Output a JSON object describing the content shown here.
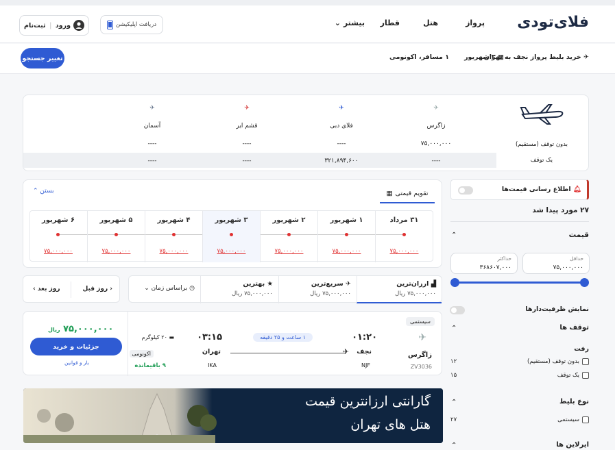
{
  "header": {
    "logo": "فلای‌تودی",
    "nav": [
      "پرواز",
      "هتل",
      "قطار",
      "بیشتر"
    ],
    "app_download": "دریافت اپلیکیشن",
    "login": "ورود",
    "signup": "ثبت‌نام"
  },
  "search_summary": {
    "route": "خرید بلیط پرواز نجف به تهران",
    "date": "۳ شهریور",
    "passengers": "۱ مسافر، اکونومی",
    "change_button": "تغییر جستجو"
  },
  "airline_table": {
    "row_labels": [
      "بدون توقف (مستقیم)",
      "یک توقف"
    ],
    "airlines": [
      {
        "name": "زاگرس",
        "direct": "۷۵,۰۰۰,۰۰۰",
        "one_stop": "----"
      },
      {
        "name": "فلای دبی",
        "direct": "----",
        "one_stop": "۳۲۱,۸۹۴,۶۰۰"
      },
      {
        "name": "قشم ایر",
        "direct": "----",
        "one_stop": "----"
      },
      {
        "name": "آسمان",
        "direct": "----",
        "one_stop": "----"
      }
    ]
  },
  "price_calendar": {
    "tab": "تقویم قیمتی",
    "close": "بستن",
    "dates": [
      {
        "label": "۳۱ مرداد",
        "price": "۷۵,۰۰۰,۰۰۰"
      },
      {
        "label": "۱ شهریور",
        "price": "۷۵,۰۰۰,۰۰۰"
      },
      {
        "label": "۲ شهریور",
        "price": "۷۵,۰۰۰,۰۰۰"
      },
      {
        "label": "۳ شهریور",
        "price": "۷۵,۰۰۰,۰۰۰"
      },
      {
        "label": "۴ شهریور",
        "price": "۷۵,۰۰۰,۰۰۰"
      },
      {
        "label": "۵ شهریور",
        "price": "۷۵,۰۰۰,۰۰۰"
      },
      {
        "label": "۶ شهریور",
        "price": "۷۵,۰۰۰,۰۰۰"
      }
    ],
    "selected_index": 3
  },
  "sort_tabs": [
    {
      "title": "ارزان‌ترین",
      "value": "۷۵,۰۰۰,۰۰۰ ریال"
    },
    {
      "title": "سریع‌ترین",
      "value": "۷۵,۰۰۰,۰۰۰ ریال"
    },
    {
      "title": "بهترین",
      "value": "۷۵,۰۰۰,۰۰۰ ریال"
    }
  ],
  "sort_by_time": "براساس زمان",
  "prev_day": "روز قبل",
  "next_day": "روز بعد",
  "filters": {
    "price_alert": "اطلاع رسانی قیمت‌ها",
    "result_count": "۲۷ مورد پیدا شد",
    "price_title": "قیمت",
    "min_label": "حداقل",
    "min_value": "۷۵,۰۰۰,۰۰۰",
    "max_label": "حداکثر",
    "max_value": "۳۶۸۶۰۷,۰۰۰",
    "show_capacity": "نمایش ظرفیت‌دارها",
    "stops_title": "توقف ها",
    "outbound": "رفت",
    "stop_options": [
      {
        "label": "بدون توقف (مستقیم)",
        "count": "۱۲"
      },
      {
        "label": "یک توقف",
        "count": "۱۵"
      }
    ],
    "ticket_type_title": "نوع بلیط",
    "ticket_options": [
      {
        "label": "سیستمی",
        "count": "۲۷"
      }
    ],
    "airlines_title": "ایرلاین ها"
  },
  "flight": {
    "tag": "سیستمی",
    "airline": "زاگرس",
    "flight_no": "ZV3036",
    "dep_time": "۰۱:۲۰",
    "dep_city": "نجف",
    "dep_code": "NJF",
    "duration": "۱ ساعت و ۲۵ دقیقه",
    "arr_time": "۰۳:۱۵",
    "arr_city": "تهران",
    "arr_code": "IKA",
    "baggage": "۲۰ کیلوگرم",
    "cabin": "اکونومی",
    "seats": "۹ باقیمانده",
    "price": "۷۵,۰۰۰,۰۰۰",
    "currency": "ریال",
    "buy_button": "جزئیات و خرید",
    "rules": "بار و قوانین"
  },
  "banner": {
    "line1": "گارانتی ارزانترین قیمت",
    "line2": "هتل های تهران"
  },
  "colors": {
    "primary": "#2f5bd3",
    "price_red": "#e03131",
    "green": "#1f9d55"
  }
}
